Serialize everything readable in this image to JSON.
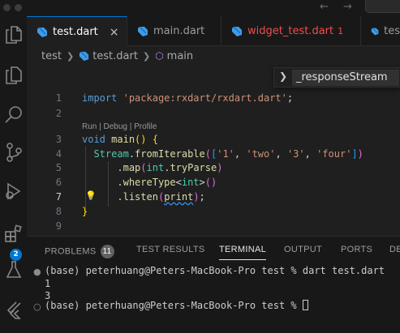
{
  "tabs": [
    {
      "label": "test.dart",
      "active": true,
      "close": "×"
    },
    {
      "label": "main.dart",
      "active": false
    },
    {
      "label": "widget_test.dart",
      "active": false,
      "errors": "1"
    },
    {
      "label": "tes",
      "active": false
    }
  ],
  "breadcrumb": [
    "test",
    "test.dart",
    "main"
  ],
  "sticky": {
    "label": "_responseStream"
  },
  "activity_badge": "2",
  "editor": {
    "line_numbers": [
      "1",
      "2",
      "3",
      "4",
      "5",
      "6",
      "7",
      "8",
      "9"
    ],
    "active_line": "7",
    "codelens": "Run | Debug | Profile",
    "lines": {
      "l1_kw": "import",
      "l1_str": "'package:rxdart/rxdart.dart'",
      "l1_end": ";",
      "l3_ty": "void",
      "l3_fn": "main",
      "l3_rest": "() {",
      "l4_ty": "Stream",
      "l4_dot": ".",
      "l4_fn": "fromIterable",
      "l4_s1": "'1'",
      "l4_s2": "'two'",
      "l4_s3": "'3'",
      "l4_s4": "'four'",
      "l5_fn": "map",
      "l5_ty": "int",
      "l5_fn2": "tryParse",
      "l6_fn": "whereType",
      "l6_ty": "int",
      "l7_fn": "listen",
      "l7_arg": "print",
      "l8": "}"
    }
  },
  "panel": {
    "tabs": [
      "PROBLEMS",
      "TEST RESULTS",
      "TERMINAL",
      "OUTPUT",
      "PORTS",
      "DE"
    ],
    "problems_count": "11",
    "active_tab": "TERMINAL"
  },
  "terminal": {
    "line1": "(base) peterhuang@Peters-MacBook-Pro test % dart test.dart",
    "line2": "1",
    "line3": "3",
    "line4": "(base) peterhuang@Peters-MacBook-Pro test % "
  },
  "colors": {
    "accent": "#0078d4",
    "error": "#f14c4c",
    "keyword": "#569cd6",
    "string": "#ce9178"
  }
}
